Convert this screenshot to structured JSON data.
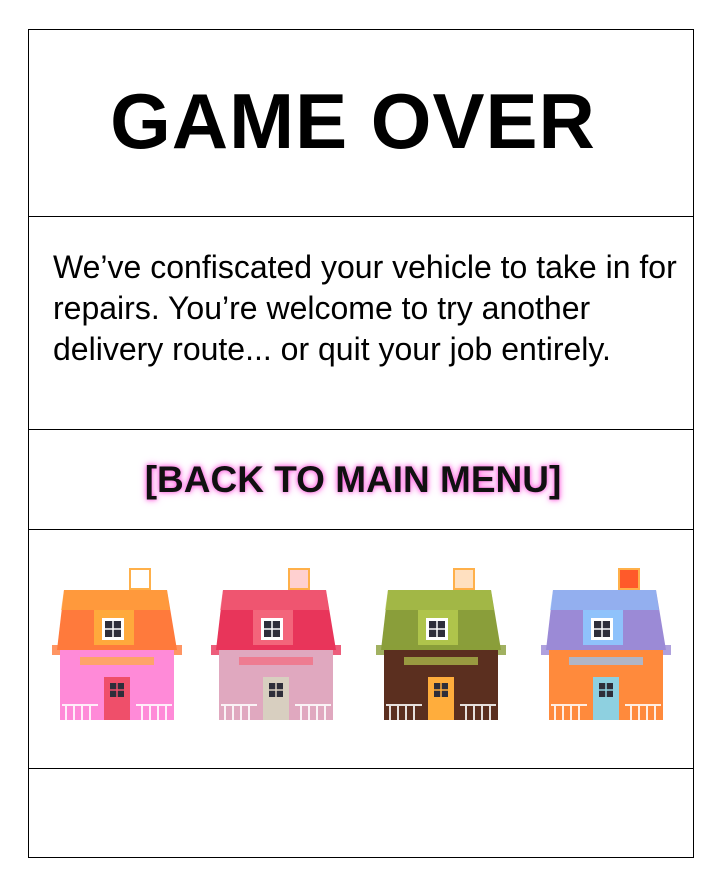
{
  "title": "GAME OVER",
  "message": "We’ve confiscated your vehicle to take in for repairs. You’re welcome to try another delivery route... or quit your job entirely.",
  "menu_link": "[BACK TO MAIN MENU]",
  "houses": [
    {
      "roof": "#ff7a3c",
      "roof2": "#ffae3c",
      "wall": "#ff8ad8",
      "door": "#ef4f6a",
      "chimney": "#ffffff"
    },
    {
      "roof": "#e8355a",
      "roof2": "#f46a7e",
      "wall": "#e0a8bf",
      "door": "#d8cfc0",
      "chimney": "#ffd0d0"
    },
    {
      "roof": "#8a9e3a",
      "roof2": "#b3c84e",
      "wall": "#5b2f1f",
      "door": "#ffad3c",
      "chimney": "#ffe0c0"
    },
    {
      "roof": "#9b8ad6",
      "roof2": "#8ec8ff",
      "wall": "#ff8a3c",
      "door": "#8ed0e0",
      "chimney": "#ff5a2a"
    }
  ]
}
